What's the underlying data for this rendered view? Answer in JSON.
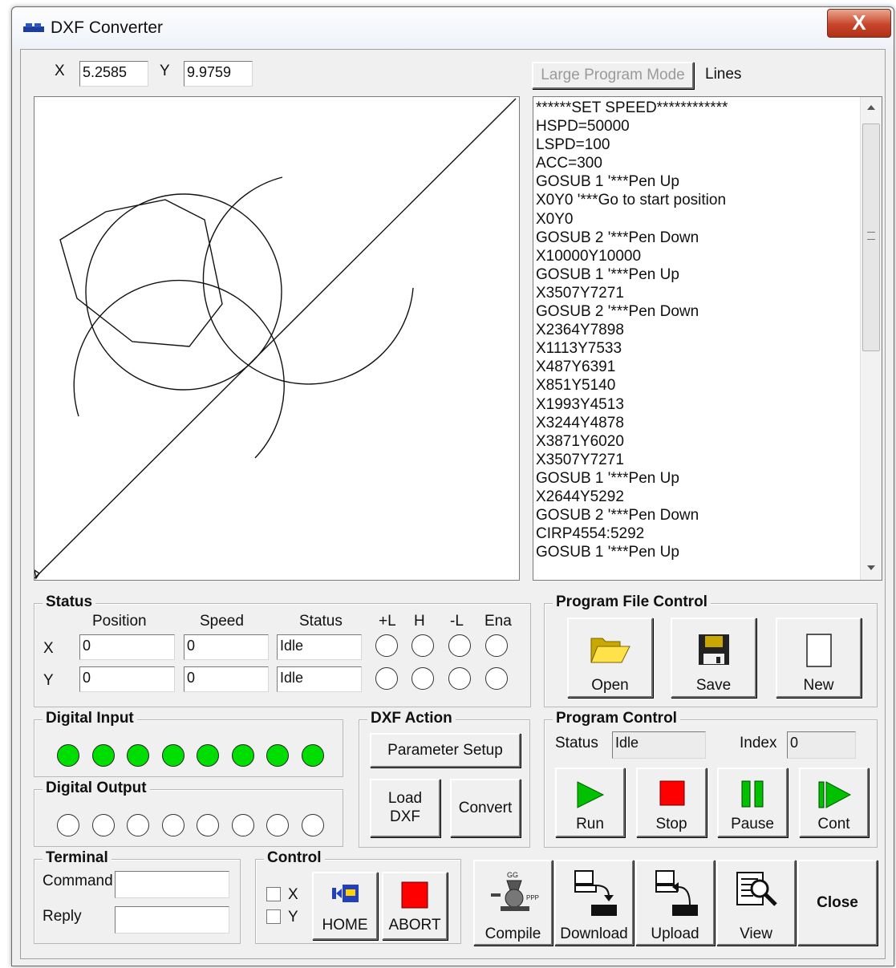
{
  "window": {
    "title": "DXF Converter",
    "close_glyph": "X"
  },
  "coords": {
    "x_label": "X",
    "x_value": "5.2585",
    "y_label": "Y",
    "y_value": "9.9759"
  },
  "program_mode": {
    "large_button": "Large Program Mode",
    "lines_label": "Lines"
  },
  "code_lines": [
    "******SET SPEED************",
    "HSPD=50000",
    "LSPD=100",
    "ACC=300",
    "GOSUB 1 '***Pen Up",
    "X0Y0 '***Go to start position",
    "X0Y0",
    "GOSUB 2 '***Pen Down",
    "X10000Y10000",
    "GOSUB 1 '***Pen Up",
    "X3507Y7271",
    "GOSUB 2 '***Pen Down",
    "X2364Y7898",
    "X1113Y7533",
    "X487Y6391",
    "X851Y5140",
    "X1993Y4513",
    "X3244Y4878",
    "X3871Y6020",
    "X3507Y7271",
    "GOSUB 1 '***Pen Up",
    "X2644Y5292",
    "GOSUB 2 '***Pen Down",
    "CIRP4554:5292",
    "GOSUB 1 '***Pen Up"
  ],
  "status": {
    "title": "Status",
    "col_position": "Position",
    "col_speed": "Speed",
    "col_status": "Status",
    "col_plus_l": "+L",
    "col_h": "H",
    "col_minus_l": "-L",
    "col_ena": "Ena",
    "row_x": "X",
    "row_y": "Y",
    "x_position": "0",
    "x_speed": "0",
    "x_status": "Idle",
    "y_position": "0",
    "y_speed": "0",
    "y_status": "Idle"
  },
  "program_file_control": {
    "title": "Program File Control",
    "open": "Open",
    "save": "Save",
    "new": "New"
  },
  "digital_input": {
    "title": "Digital Input",
    "states": [
      true,
      true,
      true,
      true,
      true,
      true,
      true,
      true
    ]
  },
  "digital_output": {
    "title": "Digital Output",
    "states": [
      false,
      false,
      false,
      false,
      false,
      false,
      false,
      false
    ]
  },
  "dxf_action": {
    "title": "DXF Action",
    "parameter_setup": "Parameter Setup",
    "load_dxf_1": "Load",
    "load_dxf_2": "DXF",
    "convert": "Convert"
  },
  "program_control": {
    "title": "Program Control",
    "status_label": "Status",
    "status_value": "Idle",
    "index_label": "Index",
    "index_value": "0",
    "run": "Run",
    "stop": "Stop",
    "pause": "Pause",
    "cont": "Cont"
  },
  "terminal": {
    "title": "Terminal",
    "command_label": "Command",
    "reply_label": "Reply"
  },
  "control": {
    "title": "Control",
    "x_label": "X",
    "y_label": "Y",
    "home": "HOME",
    "abort": "ABORT"
  },
  "bottom_actions": {
    "compile": "Compile",
    "download": "Download",
    "upload": "Upload",
    "view": "View",
    "close": "Close"
  },
  "colors": {
    "led_on": "#00dd00",
    "stop_red": "#ff0000",
    "run_green": "#00c000",
    "abort_red": "#ff0000"
  }
}
